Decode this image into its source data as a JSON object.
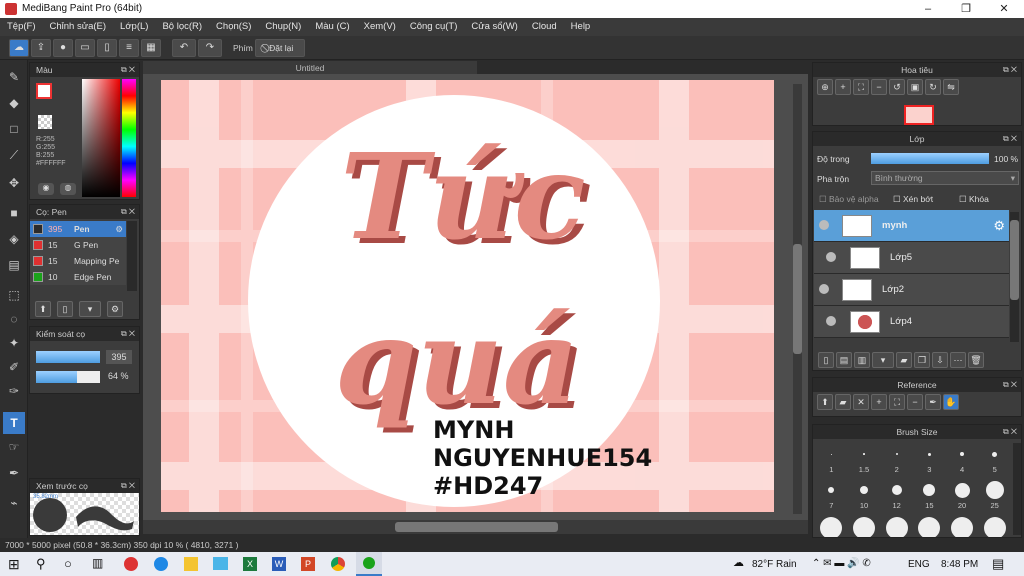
{
  "app": {
    "title": "MediBang Paint Pro (64bit)"
  },
  "window_controls": [
    "–",
    "❐",
    "✕"
  ],
  "menu": [
    "Tệp(F)",
    "Chỉnh sửa(E)",
    "Lớp(L)",
    "Bộ lọc(R)",
    "Chọn(S)",
    "Chụp(N)",
    "Màu (C)",
    "Xem(V)",
    "Công cụ(T)",
    "Cửa sổ(W)",
    "Cloud",
    "Help"
  ],
  "toolbar": {
    "phim_label": "Phím",
    "reset_label": "Đặt lại"
  },
  "color_panel": {
    "title": "Màu",
    "readout": [
      "R:255",
      "G:255",
      "B:255",
      "#FFFFFF"
    ],
    "fg": "#ffffff",
    "bg": "#ffffff"
  },
  "brush_panel": {
    "title": "Cọ: Pen",
    "items": [
      {
        "size": "395",
        "name": "Pen",
        "color": "#2b2b2b",
        "selected": true
      },
      {
        "size": "15",
        "name": "G Pen",
        "color": "#e03030",
        "selected": false
      },
      {
        "size": "15",
        "name": "Mapping Pe",
        "color": "#e03030",
        "selected": false
      },
      {
        "size": "10",
        "name": "Edge Pen",
        "color": "#1aa31a",
        "selected": false
      }
    ]
  },
  "brush_control": {
    "title": "Kiểm soát cọ",
    "size_value": "395",
    "opacity_value": "64 %",
    "size_fraction": 1.0,
    "opacity_fraction": 0.64
  },
  "brush_preview": {
    "title": "Xem trước cọ",
    "size_label": "35.82mm"
  },
  "document": {
    "tab": "Untitled"
  },
  "artwork": {
    "line1": "Tức",
    "line2": "quá",
    "credit": [
      "MYNH",
      "NGUYENHUE154",
      "#HD247"
    ]
  },
  "navigator": {
    "title": "Hoa tiêu"
  },
  "layer_panel": {
    "title": "Lớp",
    "opacity_label": "Độ trong",
    "opacity_value": "100 %",
    "opacity_fraction": 1.0,
    "blend_label": "Pha trộn",
    "blend_value": "Bình thường",
    "checks": [
      "Bảo vệ alpha",
      "Xén bớt",
      "Khóa"
    ],
    "layers": [
      {
        "name": "mynh",
        "selected": true,
        "indent": false
      },
      {
        "name": "Lớp5",
        "selected": false,
        "indent": true
      },
      {
        "name": "Lớp2",
        "selected": false,
        "indent": false
      },
      {
        "name": "Lớp4",
        "selected": false,
        "indent": true
      }
    ]
  },
  "reference": {
    "title": "Reference"
  },
  "brush_size": {
    "title": "Brush Size",
    "row1": [
      "1",
      "1.5",
      "2",
      "3",
      "4",
      "5"
    ],
    "row2": [
      "7",
      "10",
      "12",
      "15",
      "20",
      "25"
    ]
  },
  "status": {
    "text": "7000 * 5000 pixel  (50.8 * 36.3cm)  350 dpi  10 %  ( 4810, 3271 )"
  },
  "taskbar": {
    "weather": "82°F  Rain",
    "lang": "ENG",
    "time": "8:48 PM"
  }
}
